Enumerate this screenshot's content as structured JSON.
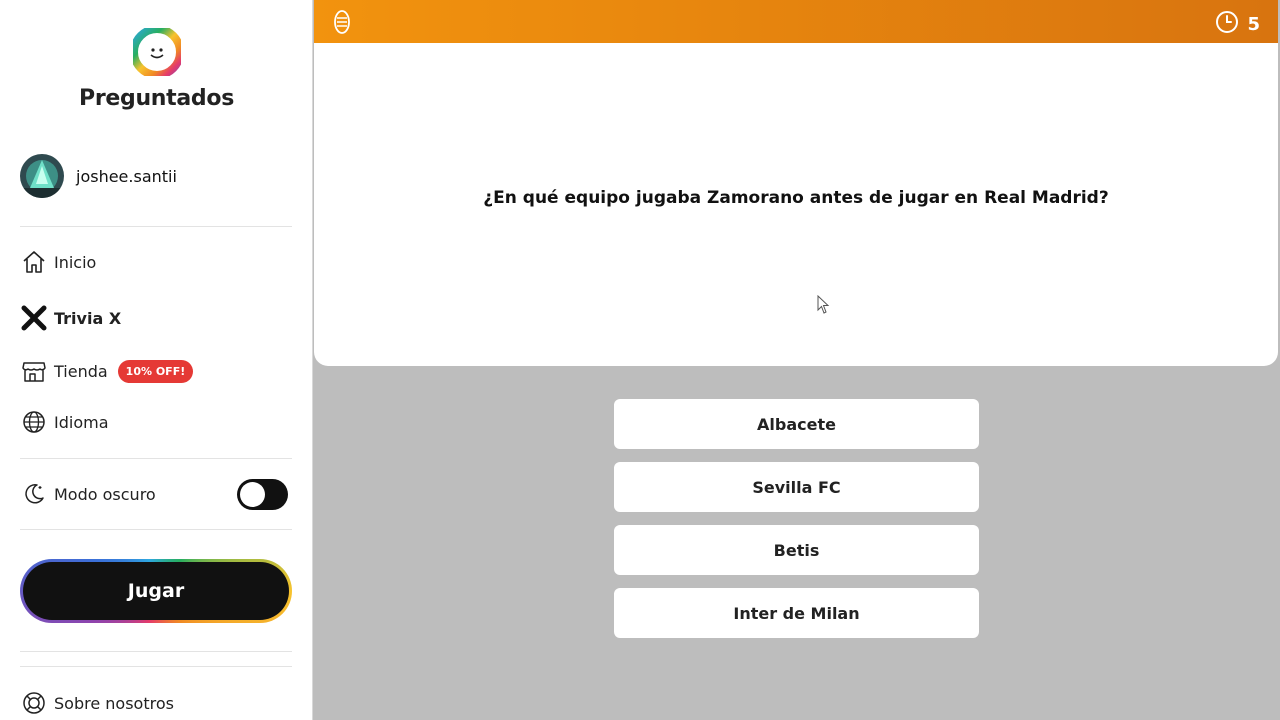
{
  "app": {
    "name": "Preguntados"
  },
  "user": {
    "username": "joshee.santii"
  },
  "nav": {
    "items": [
      {
        "label": "Inicio",
        "icon": "home-icon"
      },
      {
        "label": "Trivia X",
        "icon": "x-icon",
        "active": true
      },
      {
        "label": "Tienda",
        "icon": "store-icon",
        "badge": "10% OFF!"
      },
      {
        "label": "Idioma",
        "icon": "globe-icon"
      }
    ],
    "dark_mode": {
      "label": "Modo oscuro",
      "enabled": false
    },
    "play_label": "Jugar",
    "about_label": "Sobre nosotros"
  },
  "game": {
    "timer": "5",
    "category_color": "#f2930e",
    "question": "¿En qué equipo jugaba Zamorano antes de jugar en Real Madrid?",
    "answers": [
      "Albacete",
      "Sevilla FC",
      "Betis",
      "Inter de Milan"
    ]
  }
}
